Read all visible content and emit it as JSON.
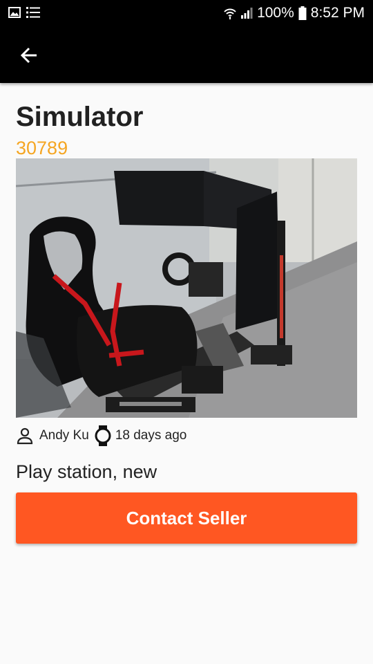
{
  "status_bar": {
    "battery": "100%",
    "time": "8:52 PM",
    "icons": [
      "gallery-icon",
      "list-icon",
      "wifi-icon",
      "signal-icon",
      "battery-icon"
    ]
  },
  "app_bar": {
    "back_icon": "arrow-back-icon"
  },
  "listing": {
    "title": "Simulator",
    "price": "30789",
    "seller": "Andy Ku",
    "posted": "18 days ago",
    "description": "Play station, new",
    "contact_label": "Contact Seller"
  },
  "colors": {
    "accent": "#ff5722",
    "price": "#f5a623",
    "bar": "#000000"
  }
}
